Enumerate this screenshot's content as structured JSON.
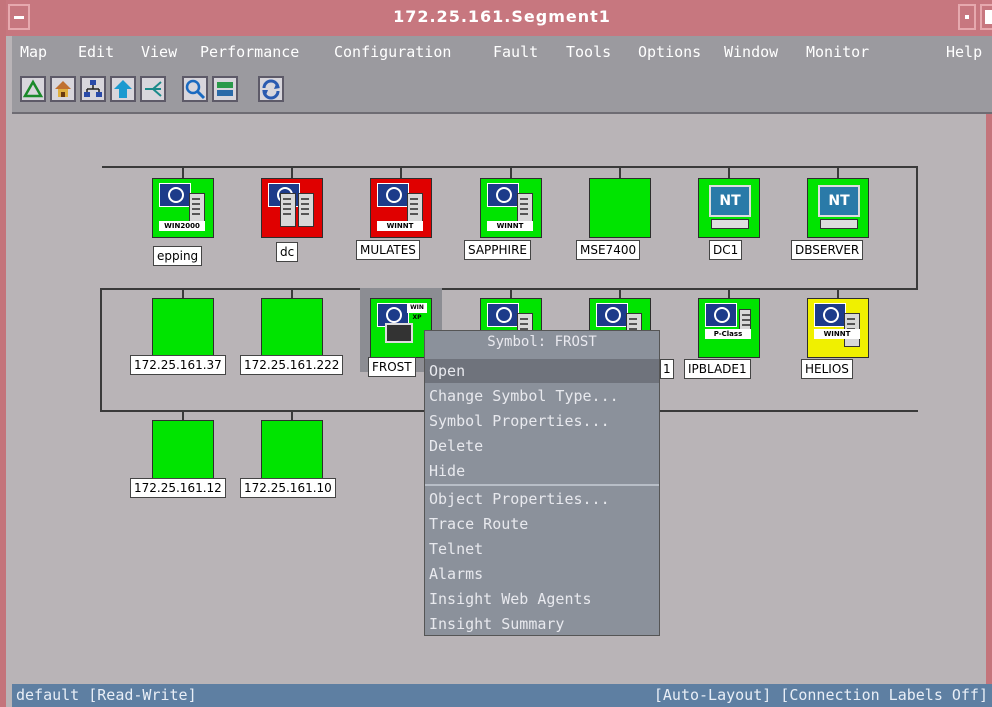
{
  "window": {
    "title": "172.25.161.Segment1"
  },
  "menu": [
    {
      "label": "Map"
    },
    {
      "label": "Edit"
    },
    {
      "label": "View"
    },
    {
      "label": "Performance"
    },
    {
      "label": "Configuration"
    },
    {
      "label": "Fault"
    },
    {
      "label": "Tools"
    },
    {
      "label": "Options"
    },
    {
      "label": "Window"
    },
    {
      "label": "Monitor"
    },
    {
      "label": "Help"
    }
  ],
  "toolbar": [
    {
      "icon": "triangle-ruler-icon"
    },
    {
      "icon": "home-icon"
    },
    {
      "icon": "network-tree-icon"
    },
    {
      "icon": "up-arrow-icon"
    },
    {
      "icon": "branch-icon"
    },
    {
      "icon": "magnifier-icon"
    },
    {
      "icon": "network-switch-icon"
    },
    {
      "icon": "refresh-icon"
    }
  ],
  "nodes": {
    "row1": [
      {
        "label": "epping",
        "status": "green",
        "os": "WIN2000",
        "kind": "server"
      },
      {
        "label": "dc",
        "status": "red",
        "os": "",
        "kind": "server-pair"
      },
      {
        "label": "MULATES",
        "status": "red",
        "os": "WINNT",
        "kind": "server"
      },
      {
        "label": "SAPPHIRE",
        "status": "green",
        "os": "WINNT",
        "kind": "server"
      },
      {
        "label": "MSE7400",
        "status": "green",
        "os": "",
        "kind": "blank"
      },
      {
        "label": "DC1",
        "status": "green",
        "os": "NT",
        "kind": "workstation"
      },
      {
        "label": "DBSERVER",
        "status": "green",
        "os": "NT",
        "kind": "workstation"
      }
    ],
    "row2": [
      {
        "label": "172.25.161.37",
        "status": "green",
        "kind": "blank"
      },
      {
        "label": "172.25.161.222",
        "status": "green",
        "kind": "blank"
      },
      {
        "label": "FROST",
        "status": "green",
        "os": "WIN XP",
        "kind": "workstation-selected"
      },
      {
        "label": "",
        "status": "green",
        "kind": "server"
      },
      {
        "label": "1",
        "status": "green",
        "kind": "server"
      },
      {
        "label": "IPBLADE1",
        "status": "green",
        "os": "P-Class",
        "kind": "blade"
      },
      {
        "label": "HELIOS",
        "status": "yellow",
        "os": "WINNT",
        "kind": "server"
      }
    ],
    "row3": [
      {
        "label": "172.25.161.12",
        "status": "green",
        "kind": "blank"
      },
      {
        "label": "172.25.161.10",
        "status": "green",
        "kind": "blank"
      }
    ]
  },
  "context_menu": {
    "title": "Symbol: FROST",
    "group1": [
      "Open",
      "Change Symbol Type...",
      "Symbol Properties...",
      "Delete",
      "Hide"
    ],
    "group2": [
      "Object Properties...",
      "Trace Route",
      "Telnet",
      "Alarms",
      "Insight Web Agents",
      "Insight Summary"
    ]
  },
  "status": {
    "left": "default [Read-Write]",
    "right": "[Auto-Layout] [Connection Labels Off]"
  }
}
